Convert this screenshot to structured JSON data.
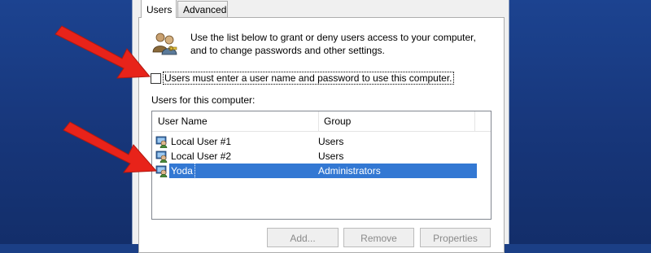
{
  "tabs": [
    {
      "label": "Users",
      "active": true
    },
    {
      "label": "Advanced",
      "active": false
    }
  ],
  "intro_text": "Use the list below to grant or deny users access to your computer, and to change passwords and other settings.",
  "require_login": {
    "label": "Users must enter a user name and password to use this computer.",
    "checked": false
  },
  "users_caption": "Users for this computer:",
  "columns": [
    "User Name",
    "Group"
  ],
  "users": [
    {
      "name": "Local User #1",
      "group": "Users",
      "selected": false
    },
    {
      "name": "Local User #2",
      "group": "Users",
      "selected": false
    },
    {
      "name": "Yoda",
      "group": "Administrators",
      "selected": true
    }
  ],
  "buttons": {
    "add": "Add...",
    "remove": "Remove",
    "properties": "Properties"
  },
  "colors": {
    "desktop": "#1b3f86",
    "selection": "#3378d3",
    "annotation_arrow": "#e8231a"
  }
}
